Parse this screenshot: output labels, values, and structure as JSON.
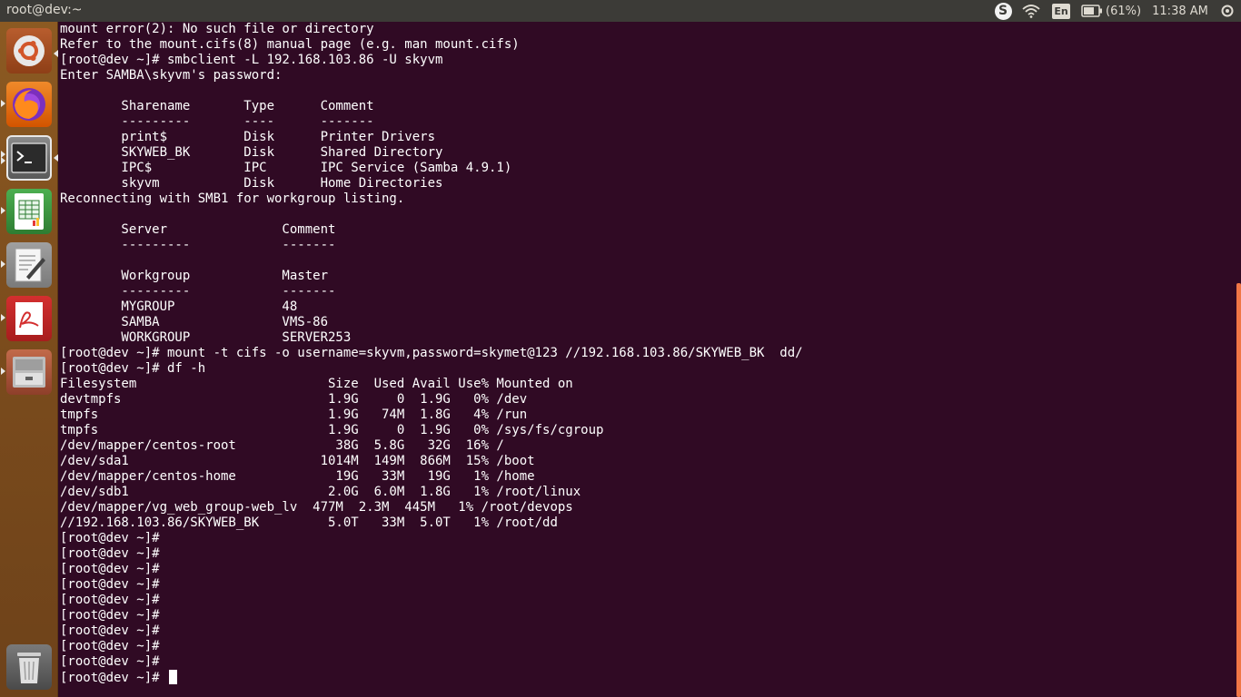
{
  "top_bar": {
    "window_title": "root@dev:~",
    "skype_label": "S",
    "keyboard_layout": "En",
    "battery_percent": "(61%)",
    "clock": "11:38 AM"
  },
  "launcher": {
    "items": [
      {
        "name": "ubuntu-dash",
        "icon": "ubuntu-logo-icon"
      },
      {
        "name": "firefox",
        "icon": "firefox-icon"
      },
      {
        "name": "terminal",
        "icon": "terminal-icon",
        "active": true
      },
      {
        "name": "libreoffice-calc",
        "icon": "spreadsheet-icon"
      },
      {
        "name": "text-editor",
        "icon": "text-editor-icon"
      },
      {
        "name": "pdf-viewer",
        "icon": "pdf-icon"
      },
      {
        "name": "file-manager",
        "icon": "file-cabinet-icon"
      },
      {
        "name": "trash",
        "icon": "trash-icon"
      }
    ]
  },
  "terminal": {
    "lines": [
      "mount error(2): No such file or directory",
      "Refer to the mount.cifs(8) manual page (e.g. man mount.cifs)",
      "[root@dev ~]# smbclient -L 192.168.103.86 -U skyvm",
      "Enter SAMBA\\skyvm's password:",
      "",
      "        Sharename       Type      Comment",
      "        ---------       ----      -------",
      "        print$          Disk      Printer Drivers",
      "        SKYWEB_BK       Disk      Shared Directory",
      "        IPC$            IPC       IPC Service (Samba 4.9.1)",
      "        skyvm           Disk      Home Directories",
      "Reconnecting with SMB1 for workgroup listing.",
      "",
      "        Server               Comment",
      "        ---------            -------",
      "",
      "        Workgroup            Master",
      "        ---------            -------",
      "        MYGROUP              48",
      "        SAMBA                VMS-86",
      "        WORKGROUP            SERVER253",
      "[root@dev ~]# mount -t cifs -o username=skyvm,password=skymet@123 //192.168.103.86/SKYWEB_BK  dd/",
      "[root@dev ~]# df -h",
      "Filesystem                         Size  Used Avail Use% Mounted on",
      "devtmpfs                           1.9G     0  1.9G   0% /dev",
      "tmpfs                              1.9G   74M  1.8G   4% /run",
      "tmpfs                              1.9G     0  1.9G   0% /sys/fs/cgroup",
      "/dev/mapper/centos-root             38G  5.8G   32G  16% /",
      "/dev/sda1                         1014M  149M  866M  15% /boot",
      "/dev/mapper/centos-home             19G   33M   19G   1% /home",
      "/dev/sdb1                          2.0G  6.0M  1.8G   1% /root/linux",
      "/dev/mapper/vg_web_group-web_lv  477M  2.3M  445M   1% /root/devops",
      "//192.168.103.86/SKYWEB_BK         5.0T   33M  5.0T   1% /root/dd",
      "[root@dev ~]#",
      "[root@dev ~]#",
      "[root@dev ~]#",
      "[root@dev ~]#",
      "[root@dev ~]#",
      "[root@dev ~]#",
      "[root@dev ~]#",
      "[root@dev ~]#",
      "[root@dev ~]#"
    ],
    "prompt": "[root@dev ~]# "
  }
}
